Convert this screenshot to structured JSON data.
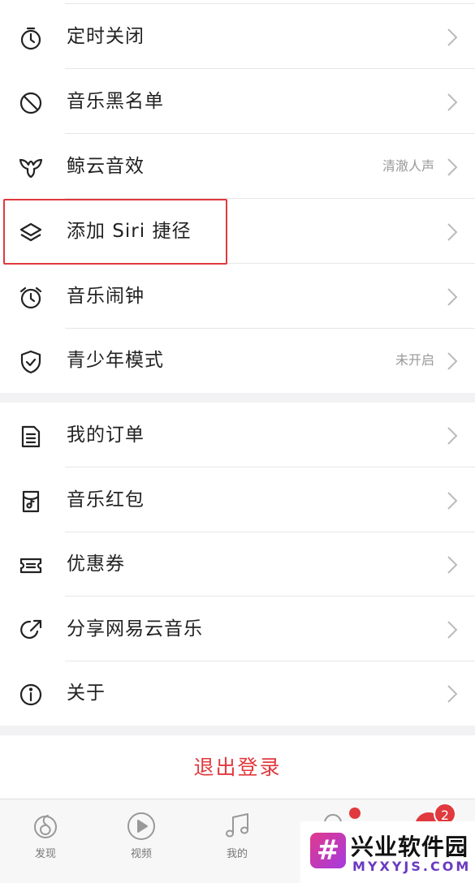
{
  "settings_group_1": [
    {
      "label": "定时关闭",
      "sub": "",
      "icon": "timer-icon"
    },
    {
      "label": "音乐黑名单",
      "sub": "",
      "icon": "block-icon"
    },
    {
      "label": "鲸云音效",
      "sub": "清澈人声",
      "icon": "whale-tail-icon"
    },
    {
      "label": "添加 Siri 捷径",
      "sub": "",
      "icon": "layers-icon"
    },
    {
      "label": "音乐闹钟",
      "sub": "",
      "icon": "alarm-clock-icon"
    },
    {
      "label": "青少年模式",
      "sub": "未开启",
      "icon": "shield-check-icon"
    }
  ],
  "settings_group_2": [
    {
      "label": "我的订单",
      "sub": "",
      "icon": "document-icon"
    },
    {
      "label": "音乐红包",
      "sub": "",
      "icon": "red-envelope-icon"
    },
    {
      "label": "优惠券",
      "sub": "",
      "icon": "ticket-icon"
    },
    {
      "label": "分享网易云音乐",
      "sub": "",
      "icon": "share-icon"
    },
    {
      "label": "关于",
      "sub": "",
      "icon": "info-icon"
    }
  ],
  "logout_label": "退出登录",
  "tabbar": {
    "items": [
      {
        "label": "发现",
        "icon": "discover-icon"
      },
      {
        "label": "视频",
        "icon": "video-play-icon"
      },
      {
        "label": "我的",
        "icon": "music-note-icon"
      },
      {
        "label": "",
        "icon": "friends-icon"
      },
      {
        "label": "",
        "icon": "account-icon"
      }
    ],
    "badge_count": "2"
  },
  "watermark": {
    "logo_glyph": "#",
    "title": "兴业软件园",
    "url": "MYXYJS.COM"
  },
  "colors": {
    "accent": "#e0393e",
    "text": "#222222",
    "sub_text": "#999999",
    "separator": "#e6e6e6",
    "background": "#f2f2f4"
  }
}
